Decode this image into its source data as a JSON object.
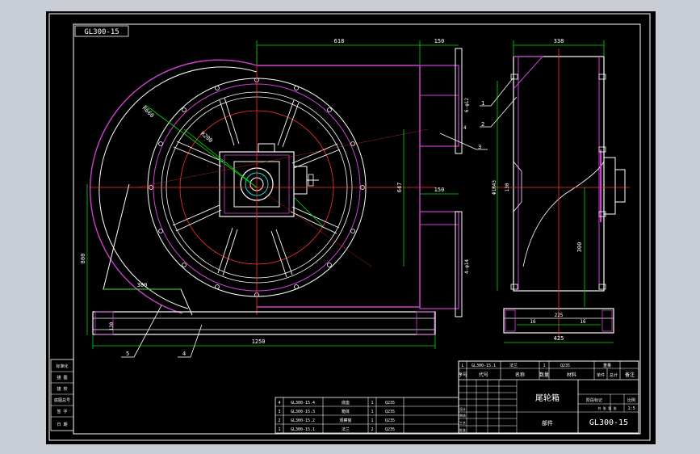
{
  "drawing": {
    "code_box": "GL300-15",
    "title": "尾轮箱",
    "drawing_no": "GL300-15",
    "dimensions": {
      "top_overall": "618",
      "top_flange": "150",
      "mid_flange": "150",
      "vertical_main": "647",
      "left_height": "800",
      "bottom_overall": "1250",
      "base_height": "130",
      "chute_width": "380",
      "right_top_width": "338",
      "right_bottom_width": "425",
      "right_vertical": "300",
      "right_base_a": "16",
      "right_base_b": "225",
      "right_base_c": "16",
      "right_inner_dim": "130",
      "right_tag": "Φ1R43",
      "bolt_hole_a": "6-φ12",
      "bolt_hole_b": "4-φ14",
      "gap": "4",
      "radius_a": "R660",
      "radius_b": "R200"
    },
    "balloons": [
      "1",
      "2",
      "3",
      "4",
      "5"
    ],
    "parts_list": [
      {
        "no": "4",
        "code": "GL300-15.4",
        "name": "底座",
        "qty": "1",
        "material": "Q235"
      },
      {
        "no": "3",
        "code": "GL300-15.3",
        "name": "箱体",
        "qty": "1",
        "material": "Q235"
      },
      {
        "no": "2",
        "code": "GL300-15.2",
        "name": "观察窗",
        "qty": "1",
        "material": "Q235"
      },
      {
        "no": "1",
        "code": "GL300-15.1",
        "name": "法兰",
        "qty": "2",
        "material": "Q235"
      }
    ],
    "title_block": {
      "top_row": [
        "L",
        "GL300-15.1",
        "法兰",
        "1",
        "Q235"
      ],
      "header": [
        "序号",
        "代号",
        "名称",
        "数量",
        "材料",
        "单件",
        "总计",
        "备注"
      ],
      "weight_label": "重量",
      "scale_label": "比例",
      "scale_value": "1:5",
      "stage_label": "阶段标记",
      "sheet_label": "共 张 第 张",
      "part_label": "部件",
      "sign_rows": [
        "设计",
        "审核",
        "工艺",
        "批准"
      ]
    },
    "left_strip": [
      "标准化",
      "描 图",
      "描 校",
      "底图总号",
      "签 字",
      "日 期"
    ]
  }
}
